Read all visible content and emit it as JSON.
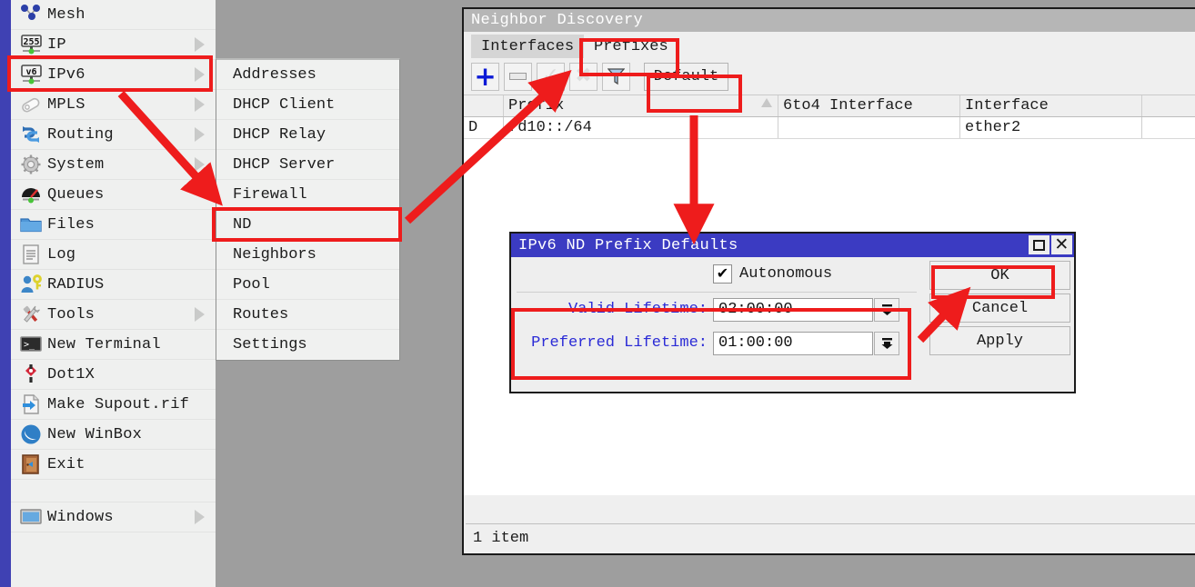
{
  "menu": {
    "items": [
      {
        "label": "Mesh",
        "icon": "mesh-icon",
        "arrow": false
      },
      {
        "label": "IP",
        "icon": "ip-255-icon",
        "arrow": true
      },
      {
        "label": "IPv6",
        "icon": "ipv6-icon",
        "arrow": true
      },
      {
        "label": "MPLS",
        "icon": "mpls-icon",
        "arrow": true
      },
      {
        "label": "Routing",
        "icon": "routing-icon",
        "arrow": true
      },
      {
        "label": "System",
        "icon": "gear-icon",
        "arrow": true
      },
      {
        "label": "Queues",
        "icon": "queues-gauge-icon",
        "arrow": false
      },
      {
        "label": "Files",
        "icon": "folder-icon",
        "arrow": false
      },
      {
        "label": "Log",
        "icon": "log-icon",
        "arrow": false
      },
      {
        "label": "RADIUS",
        "icon": "radius-user-key-icon",
        "arrow": false
      },
      {
        "label": "Tools",
        "icon": "tools-icon",
        "arrow": true
      },
      {
        "label": "New Terminal",
        "icon": "terminal-icon",
        "arrow": false
      },
      {
        "label": "Dot1X",
        "icon": "dot1x-icon",
        "arrow": false
      },
      {
        "label": "Make Supout.rif",
        "icon": "supout-file-icon",
        "arrow": false
      },
      {
        "label": "New WinBox",
        "icon": "winbox-icon",
        "arrow": false
      },
      {
        "label": "Exit",
        "icon": "exit-door-icon",
        "arrow": false
      }
    ],
    "windows_item": {
      "label": "Windows",
      "icon": "window-icon",
      "arrow": true
    }
  },
  "submenu": {
    "items": [
      {
        "label": "Addresses"
      },
      {
        "label": "DHCP Client"
      },
      {
        "label": "DHCP Relay"
      },
      {
        "label": "DHCP Server"
      },
      {
        "label": "Firewall"
      },
      {
        "label": "ND"
      },
      {
        "label": "Neighbors"
      },
      {
        "label": "Pool"
      },
      {
        "label": "Routes"
      },
      {
        "label": "Settings"
      }
    ]
  },
  "nd_window": {
    "title": "Neighbor Discovery",
    "tabs": [
      {
        "label": "Interfaces",
        "active": false
      },
      {
        "label": "Prefixes",
        "active": true
      }
    ],
    "toolbar": {
      "add_icon": "plus-icon",
      "remove_icon": "minus-icon",
      "enable_icon": "check-icon",
      "disable_icon": "cross-icon",
      "filter_icon": "funnel-icon",
      "default_label": "Default"
    },
    "table": {
      "columns": [
        "",
        "Prefix",
        "6to4 Interface",
        "Interface",
        ""
      ],
      "rows": [
        {
          "flag": "D",
          "prefix": "fd10::/64",
          "sixto4": "",
          "interface": "ether2",
          "last": ""
        }
      ]
    },
    "status": "1 item"
  },
  "dialog": {
    "title": "IPv6 ND Prefix Defaults",
    "maximize_icon": "maximize-icon",
    "close_icon": "close-icon",
    "autonomous": {
      "label": "Autonomous",
      "checked": "✔"
    },
    "fields": [
      {
        "label": "Valid Lifetime:",
        "value": "02:00:00",
        "spinner": "spinner-down-icon"
      },
      {
        "label": "Preferred Lifetime:",
        "value": "01:00:00",
        "spinner": "spinner-down-icon"
      }
    ],
    "buttons": [
      {
        "label": "OK"
      },
      {
        "label": "Cancel"
      },
      {
        "label": "Apply"
      }
    ]
  },
  "colors": {
    "accent_blue": "#3f41b3",
    "dialog_title_blue": "#3b3bc2",
    "annotation_red": "#ee1c1c",
    "field_label_blue": "#2b2bd6",
    "window_gray": "#9e9e9e"
  }
}
